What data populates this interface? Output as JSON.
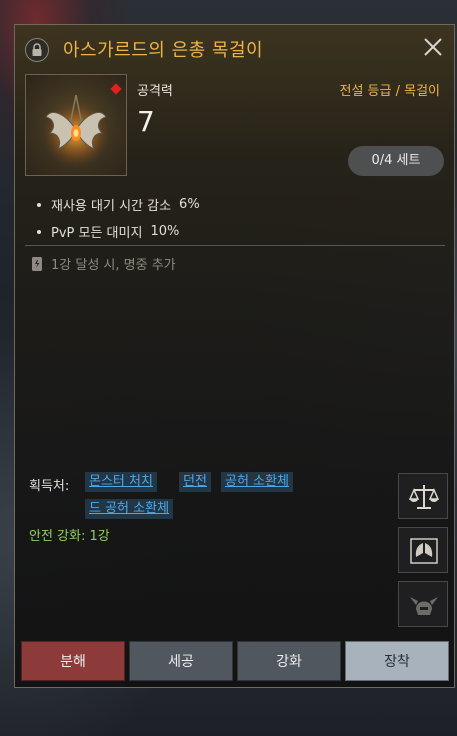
{
  "item": {
    "title": "아스가르드의 은총 목걸이",
    "stat_label": "공격력",
    "stat_value": "7",
    "grade": "전설 등급 / 목걸이",
    "set_progress": "0/4 세트"
  },
  "effects": [
    {
      "name": "재사용 대기 시간 감소",
      "value": "6%"
    },
    {
      "name": "PvP 모든 대미지",
      "value": "10%"
    }
  ],
  "upgrade_note": "1강 달성 시, 명중 추가",
  "source": {
    "label": "획득처:",
    "tags": [
      "몬스터 처치",
      "던전",
      "공허 소환체",
      "드 공허 소환체"
    ]
  },
  "safe_enhance": "안전 강화: 1강",
  "side_icons": [
    "scale-icon",
    "compare-icon",
    "helmet-icon"
  ],
  "buttons": {
    "dismantle": "분해",
    "refine": "세공",
    "enhance": "강화",
    "equip": "장착"
  },
  "colors": {
    "title": "#f0b347",
    "link": "#4fa8e6",
    "safe": "#8fcf60",
    "dismantle_button": "#8c3b3a"
  }
}
